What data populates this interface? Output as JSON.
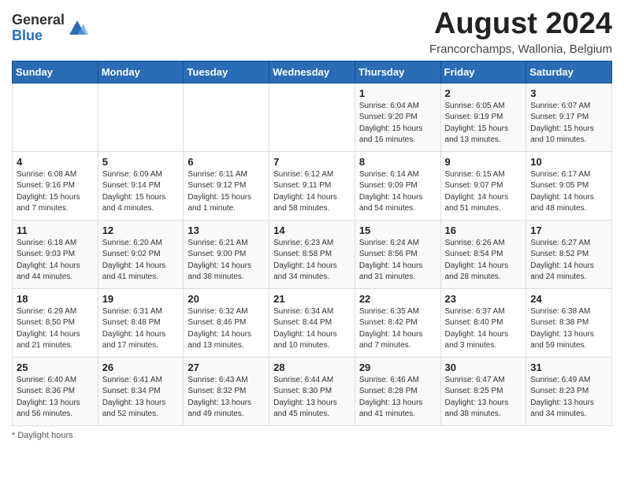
{
  "header": {
    "logo_general": "General",
    "logo_blue": "Blue",
    "month_title": "August 2024",
    "location": "Francorchamps, Wallonia, Belgium"
  },
  "weekdays": [
    "Sunday",
    "Monday",
    "Tuesday",
    "Wednesday",
    "Thursday",
    "Friday",
    "Saturday"
  ],
  "weeks": [
    [
      {
        "day": "",
        "info": ""
      },
      {
        "day": "",
        "info": ""
      },
      {
        "day": "",
        "info": ""
      },
      {
        "day": "",
        "info": ""
      },
      {
        "day": "1",
        "info": "Sunrise: 6:04 AM\nSunset: 9:20 PM\nDaylight: 15 hours and 16 minutes."
      },
      {
        "day": "2",
        "info": "Sunrise: 6:05 AM\nSunset: 9:19 PM\nDaylight: 15 hours and 13 minutes."
      },
      {
        "day": "3",
        "info": "Sunrise: 6:07 AM\nSunset: 9:17 PM\nDaylight: 15 hours and 10 minutes."
      }
    ],
    [
      {
        "day": "4",
        "info": "Sunrise: 6:08 AM\nSunset: 9:16 PM\nDaylight: 15 hours and 7 minutes."
      },
      {
        "day": "5",
        "info": "Sunrise: 6:09 AM\nSunset: 9:14 PM\nDaylight: 15 hours and 4 minutes."
      },
      {
        "day": "6",
        "info": "Sunrise: 6:11 AM\nSunset: 9:12 PM\nDaylight: 15 hours and 1 minute."
      },
      {
        "day": "7",
        "info": "Sunrise: 6:12 AM\nSunset: 9:11 PM\nDaylight: 14 hours and 58 minutes."
      },
      {
        "day": "8",
        "info": "Sunrise: 6:14 AM\nSunset: 9:09 PM\nDaylight: 14 hours and 54 minutes."
      },
      {
        "day": "9",
        "info": "Sunrise: 6:15 AM\nSunset: 9:07 PM\nDaylight: 14 hours and 51 minutes."
      },
      {
        "day": "10",
        "info": "Sunrise: 6:17 AM\nSunset: 9:05 PM\nDaylight: 14 hours and 48 minutes."
      }
    ],
    [
      {
        "day": "11",
        "info": "Sunrise: 6:18 AM\nSunset: 9:03 PM\nDaylight: 14 hours and 44 minutes."
      },
      {
        "day": "12",
        "info": "Sunrise: 6:20 AM\nSunset: 9:02 PM\nDaylight: 14 hours and 41 minutes."
      },
      {
        "day": "13",
        "info": "Sunrise: 6:21 AM\nSunset: 9:00 PM\nDaylight: 14 hours and 38 minutes."
      },
      {
        "day": "14",
        "info": "Sunrise: 6:23 AM\nSunset: 8:58 PM\nDaylight: 14 hours and 34 minutes."
      },
      {
        "day": "15",
        "info": "Sunrise: 6:24 AM\nSunset: 8:56 PM\nDaylight: 14 hours and 31 minutes."
      },
      {
        "day": "16",
        "info": "Sunrise: 6:26 AM\nSunset: 8:54 PM\nDaylight: 14 hours and 28 minutes."
      },
      {
        "day": "17",
        "info": "Sunrise: 6:27 AM\nSunset: 8:52 PM\nDaylight: 14 hours and 24 minutes."
      }
    ],
    [
      {
        "day": "18",
        "info": "Sunrise: 6:29 AM\nSunset: 8:50 PM\nDaylight: 14 hours and 21 minutes."
      },
      {
        "day": "19",
        "info": "Sunrise: 6:31 AM\nSunset: 8:48 PM\nDaylight: 14 hours and 17 minutes."
      },
      {
        "day": "20",
        "info": "Sunrise: 6:32 AM\nSunset: 8:46 PM\nDaylight: 14 hours and 13 minutes."
      },
      {
        "day": "21",
        "info": "Sunrise: 6:34 AM\nSunset: 8:44 PM\nDaylight: 14 hours and 10 minutes."
      },
      {
        "day": "22",
        "info": "Sunrise: 6:35 AM\nSunset: 8:42 PM\nDaylight: 14 hours and 7 minutes."
      },
      {
        "day": "23",
        "info": "Sunrise: 6:37 AM\nSunset: 8:40 PM\nDaylight: 14 hours and 3 minutes."
      },
      {
        "day": "24",
        "info": "Sunrise: 6:38 AM\nSunset: 8:38 PM\nDaylight: 13 hours and 59 minutes."
      }
    ],
    [
      {
        "day": "25",
        "info": "Sunrise: 6:40 AM\nSunset: 8:36 PM\nDaylight: 13 hours and 56 minutes."
      },
      {
        "day": "26",
        "info": "Sunrise: 6:41 AM\nSunset: 8:34 PM\nDaylight: 13 hours and 52 minutes."
      },
      {
        "day": "27",
        "info": "Sunrise: 6:43 AM\nSunset: 8:32 PM\nDaylight: 13 hours and 49 minutes."
      },
      {
        "day": "28",
        "info": "Sunrise: 6:44 AM\nSunset: 8:30 PM\nDaylight: 13 hours and 45 minutes."
      },
      {
        "day": "29",
        "info": "Sunrise: 6:46 AM\nSunset: 8:28 PM\nDaylight: 13 hours and 41 minutes."
      },
      {
        "day": "30",
        "info": "Sunrise: 6:47 AM\nSunset: 8:25 PM\nDaylight: 13 hours and 38 minutes."
      },
      {
        "day": "31",
        "info": "Sunrise: 6:49 AM\nSunset: 8:23 PM\nDaylight: 13 hours and 34 minutes."
      }
    ]
  ],
  "footer": {
    "daylight_label": "Daylight hours"
  }
}
